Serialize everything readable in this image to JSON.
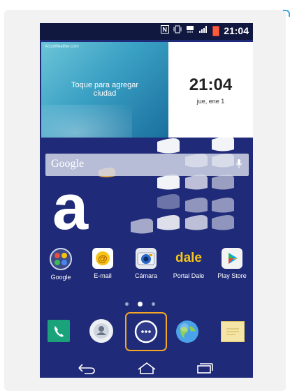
{
  "status": {
    "time": "21:04",
    "icons": [
      "nfc-icon",
      "vibrate-icon",
      "data-icon",
      "signal-icon",
      "battery-icon"
    ]
  },
  "weather_widget": {
    "brand": "AccuWeather.com",
    "message_line1": "Toque para agregar",
    "message_line2": "ciudad"
  },
  "clock_widget": {
    "time": "21:04",
    "date": "jue, ene 1"
  },
  "search": {
    "label": "Google",
    "mic_icon": "mic-icon"
  },
  "logo_letter": "a",
  "apps": [
    {
      "name": "Google",
      "icon": "google-folder-icon"
    },
    {
      "name": "E-mail",
      "icon": "email-icon"
    },
    {
      "name": "Cámara",
      "icon": "camera-icon"
    },
    {
      "name": "Portal Dale",
      "icon": "dale-icon"
    },
    {
      "name": "Play Store",
      "icon": "play-store-icon"
    }
  ],
  "page_indicator": {
    "pages": 3,
    "active": 2
  },
  "dock": [
    {
      "icon": "phone-icon"
    },
    {
      "icon": "contacts-icon"
    },
    {
      "icon": "apps-launcher-icon"
    },
    {
      "icon": "browser-globe-icon"
    },
    {
      "icon": "messages-icon"
    }
  ],
  "navbar": [
    "back-icon",
    "home-icon",
    "recent-apps-icon"
  ],
  "colors": {
    "wallpaper": "#1f2a78",
    "statusbar": "#10183f",
    "highlight": "#f5a623"
  },
  "dale_label": "dale"
}
